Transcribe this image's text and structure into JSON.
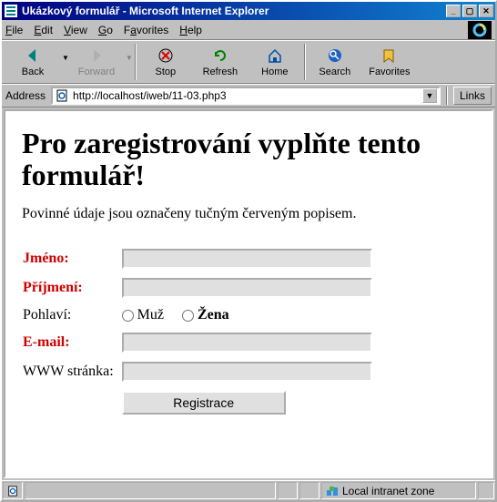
{
  "window": {
    "title": "Ukázkový formulář - Microsoft Internet Explorer"
  },
  "menu": {
    "file": "File",
    "edit": "Edit",
    "view": "View",
    "go": "Go",
    "favorites": "Favorites",
    "help": "Help"
  },
  "toolbar": {
    "back": "Back",
    "forward": "Forward",
    "stop": "Stop",
    "refresh": "Refresh",
    "home": "Home",
    "search": "Search",
    "favorites": "Favorites"
  },
  "address": {
    "label": "Address",
    "url": "http://localhost/iweb/11-03.php3",
    "links": "Links"
  },
  "page": {
    "heading": "Pro zaregistrování vyplňte tento formulář!",
    "intro": "Povinné údaje jsou označeny tučným červeným popisem.",
    "form": {
      "jmeno_label": "Jméno:",
      "prijmeni_label": "Příjmení:",
      "pohlavi_label": "Pohlaví:",
      "muz": "Muž",
      "zena": "Žena",
      "email_label": "E-mail:",
      "www_label": "WWW stránka:",
      "submit": "Registrace",
      "jmeno_value": "",
      "prijmeni_value": "",
      "email_value": "",
      "www_value": ""
    }
  },
  "status": {
    "zone": "Local intranet zone"
  }
}
